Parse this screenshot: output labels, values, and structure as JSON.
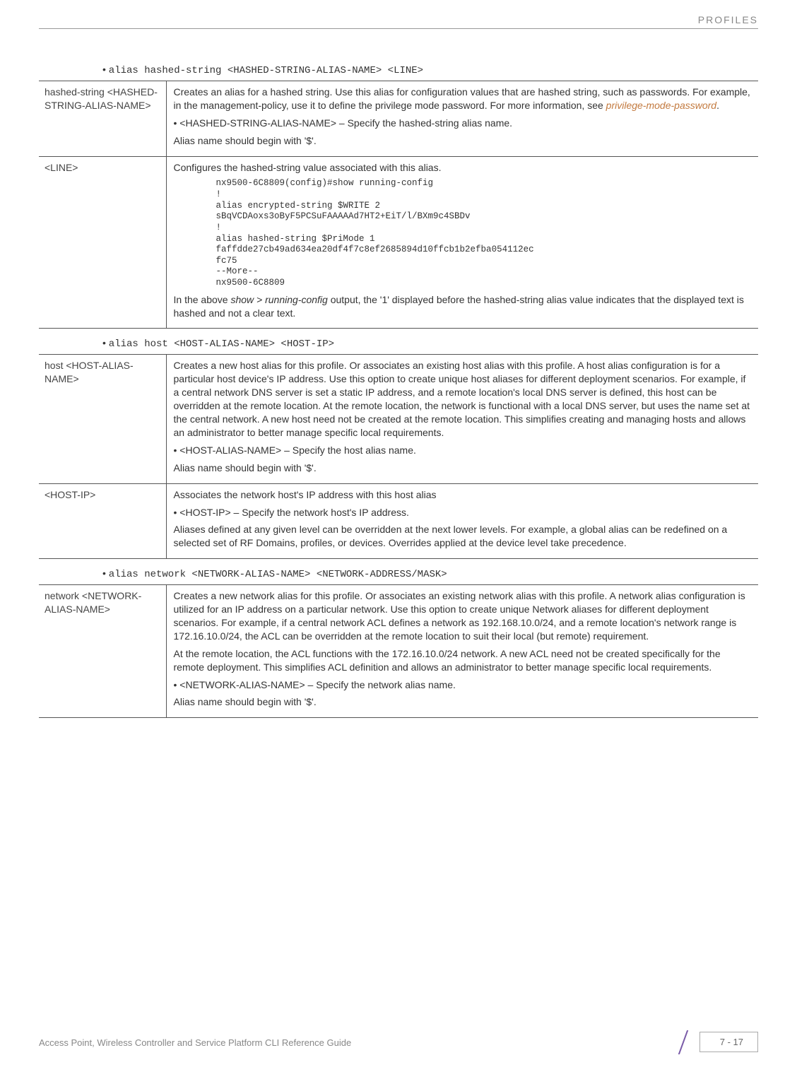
{
  "header": {
    "section": "PROFILES"
  },
  "bullets": {
    "hashed": "alias hashed-string <HASHED-STRING-ALIAS-NAME> <LINE>",
    "host": "alias host <HOST-ALIAS-NAME> <HOST-IP>",
    "network": "alias network <NETWORK-ALIAS-NAME> <NETWORK-ADDRESS/MASK>"
  },
  "table1": {
    "r1": {
      "left": "hashed-string <HASHED-STRING-ALIAS-NAME>",
      "desc1": "Creates an alias for a hashed string. Use this alias for configuration values that are hashed string, such as passwords. For example, in the management-policy, use it to define the privilege mode password. For more information, see ",
      "link": "privilege-mode-password",
      "desc1b": ".",
      "li1": "<HASHED-STRING-ALIAS-NAME> – Specify the hashed-string alias name.",
      "desc2": "Alias name should begin with '$'."
    },
    "r2": {
      "left": "<LINE>",
      "desc1": "Configures the hashed-string value associated with this alias.",
      "code": "nx9500-6C8809(config)#show running-config\n!\nalias encrypted-string $WRITE 2\nsBqVCDAoxs3oByF5PCSuFAAAAAd7HT2+EiT/l/BXm9c4SBDv\n!\nalias hashed-string $PriMode 1\nfaffdde27cb49ad634ea20df4f7c8ef2685894d10ffcb1b2efba054112ec\nfc75\n--More--\nnx9500-6C8809",
      "desc2a": "In the above ",
      "desc2i": "show > running-config",
      "desc2b": " output, the '1' displayed before the hashed-string alias value indicates that the displayed text is hashed and not a clear text."
    }
  },
  "table2": {
    "r1": {
      "left": "host <HOST-ALIAS-NAME>",
      "desc1": "Creates a new host alias for this profile. Or associates an existing host alias with this profile. A host alias configuration is for a particular host device's IP address. Use this option to create unique host aliases for different deployment scenarios. For example, if a central network DNS server is set a static IP address, and a remote location's local DNS server is defined, this host can be overridden at the remote location. At the remote location, the network is functional with a local DNS server, but uses the name set at the central network. A new host need not be created at the remote location. This simplifies creating and managing hosts and allows an administrator to better manage specific local requirements.",
      "li1": "<HOST-ALIAS-NAME> – Specify the host alias name.",
      "desc2": "Alias name should begin with '$'."
    },
    "r2": {
      "left": "<HOST-IP>",
      "desc1": "Associates the network host's IP address with this host alias",
      "li1": "<HOST-IP> – Specify the network host's IP address.",
      "desc2": "Aliases defined at any given level can be overridden at the next lower levels. For example, a global alias can be redefined on a selected set of RF Domains, profiles, or devices. Overrides applied at the device level take precedence."
    }
  },
  "table3": {
    "r1": {
      "left": "network <NETWORK-ALIAS-NAME>",
      "desc1": "Creates a new network alias for this profile. Or associates an existing network alias with this profile. A network alias configuration is utilized for an IP address on a particular network. Use this option to create unique Network aliases for different deployment scenarios. For example, if a central network ACL defines a network as 192.168.10.0/24, and a remote location's network range is 172.16.10.0/24, the ACL can be overridden at the remote location to suit their local (but remote) requirement.",
      "desc2": "At the remote location, the ACL functions with the 172.16.10.0/24 network. A new ACL need not be created specifically for the remote deployment. This simplifies ACL definition and allows an administrator to better manage specific local requirements.",
      "li1": "<NETWORK-ALIAS-NAME> – Specify the network alias name.",
      "desc3": "Alias name should begin with '$'."
    }
  },
  "footer": {
    "text": "Access Point, Wireless Controller and Service Platform CLI Reference Guide",
    "page": "7 - 17"
  }
}
